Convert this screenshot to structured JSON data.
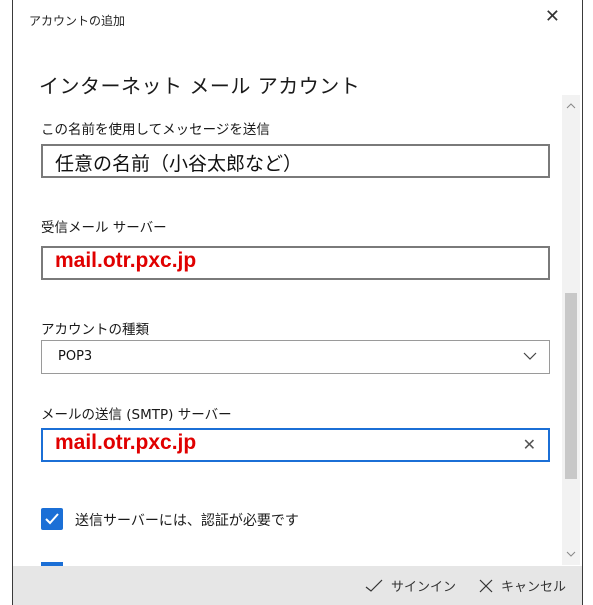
{
  "window": {
    "title": "アカウントの追加",
    "close_glyph": "✕"
  },
  "page": {
    "heading": "インターネット メール アカウント"
  },
  "form": {
    "display_name": {
      "label": "この名前を使用してメッセージを送信",
      "value": "任意の名前（小谷太郎など）"
    },
    "incoming_server": {
      "label": "受信メール サーバー",
      "value": "mail.otr.pxc.jp"
    },
    "account_type": {
      "label": "アカウントの種類",
      "value": "POP3"
    },
    "outgoing_server": {
      "label": "メールの送信 (SMTP) サーバー",
      "value": "mail.otr.pxc.jp",
      "clear_glyph": "✕"
    },
    "auth_checkbox": {
      "label": "送信サーバーには、認証が必要です",
      "checked": true
    }
  },
  "footer": {
    "signin_label": "サインイン",
    "cancel_label": "キャンセル"
  },
  "colors": {
    "accent": "#1b6fd6",
    "highlight_text": "#e00000"
  },
  "icons": [
    "close-icon",
    "chevron-down-icon",
    "checkmark-icon",
    "clear-icon",
    "scroll-up-icon",
    "scroll-down-icon"
  ]
}
